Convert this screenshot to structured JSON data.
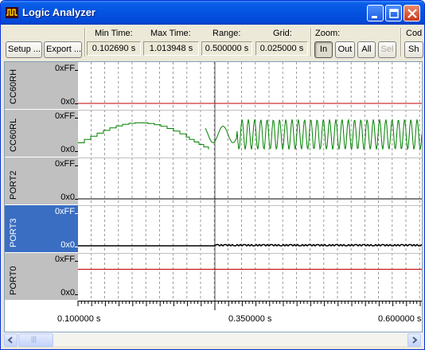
{
  "window": {
    "title": "Logic Analyzer"
  },
  "toolbar": {
    "setup_label": "Setup ...",
    "export_label": "Export ...",
    "fields": [
      {
        "label": "Min Time:",
        "value": "0.102690 s"
      },
      {
        "label": "Max Time:",
        "value": "1.013948 s"
      },
      {
        "label": "Range:",
        "value": "0.500000 s"
      },
      {
        "label": "Grid:",
        "value": "0.025000 s"
      }
    ],
    "zoom_label": "Zoom:",
    "zoom_in": "In",
    "zoom_out": "Out",
    "zoom_all": "All",
    "zoom_sel": "Sel",
    "code_label": "Cod",
    "show_label": "Sh"
  },
  "signals": [
    {
      "name": "CC60RH",
      "max_label": "0xFF",
      "min_label": "0x0",
      "selected": false,
      "color": "#c00000"
    },
    {
      "name": "CC60RL",
      "max_label": "0xFF",
      "min_label": "0x0",
      "selected": false,
      "color": "#008000"
    },
    {
      "name": "PORT2",
      "max_label": "0xFF",
      "min_label": "0x0",
      "selected": false,
      "color": "#000000"
    },
    {
      "name": "PORT3",
      "max_label": "0xFF",
      "min_label": "0x0",
      "selected": true,
      "color": "#000000"
    },
    {
      "name": "PORT0",
      "max_label": "0xFF",
      "min_label": "0x0",
      "selected": false,
      "color": "#c00000"
    }
  ],
  "time_axis": {
    "labels": [
      "0.100000 s",
      "0.350000 s",
      "0.600000 s"
    ],
    "start": 0.1,
    "grid": 0.025,
    "cursor": 0.35
  },
  "scrollbar": {
    "thumb_glyph": "|||"
  },
  "colors": {
    "selection": "#3a6ec2",
    "grid": "#808080"
  }
}
